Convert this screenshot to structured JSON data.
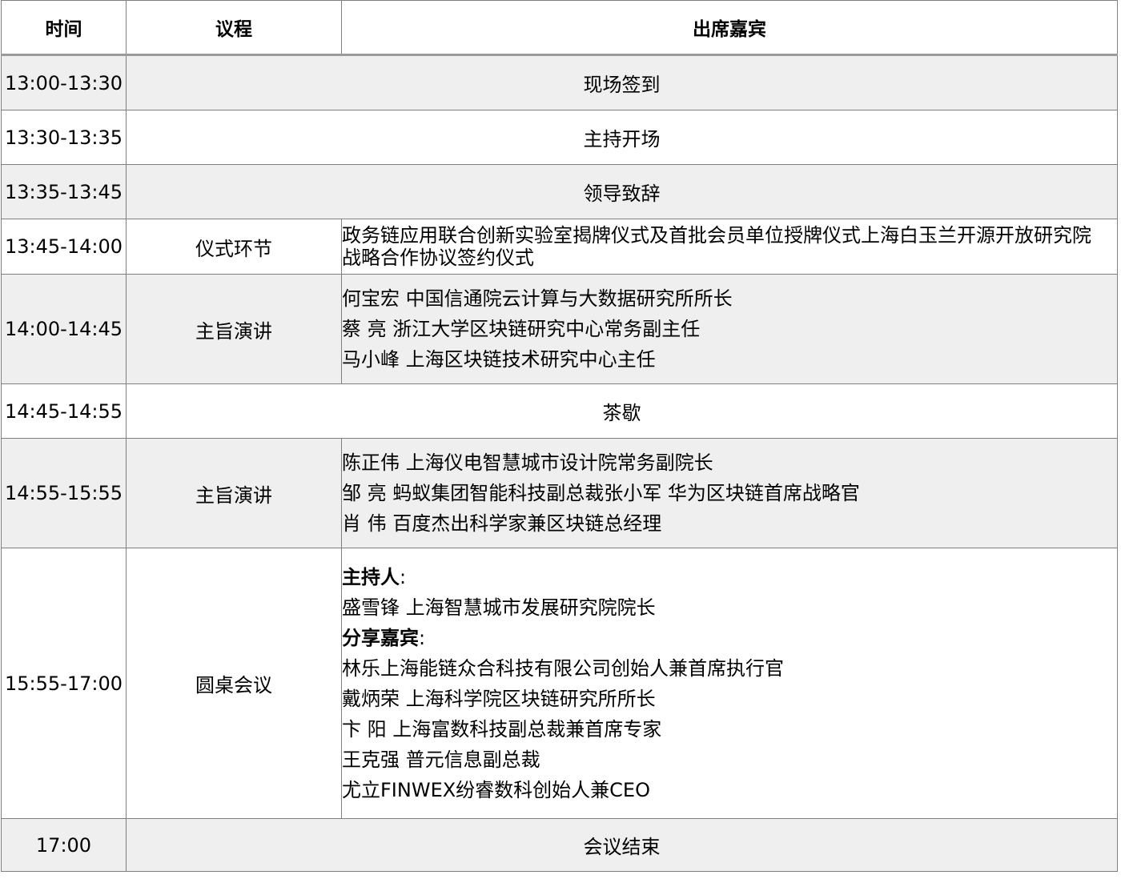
{
  "header": {
    "time": "时间",
    "agenda": "议程",
    "guests": "出席嘉宾"
  },
  "rows": [
    {
      "time": "13:00-13:30",
      "span": "现场签到"
    },
    {
      "time": "13:30-13:35",
      "span": "主持开场"
    },
    {
      "time": "13:35-13:45",
      "span": "领导致辞"
    },
    {
      "time": "13:45-14:00",
      "topic": "仪式环节",
      "guests": [
        "政务链应用联合创新实验室揭牌仪式及首批会员单位授牌仪式上海白玉兰开源开放研究院",
        "战略合作协议签约仪式"
      ]
    },
    {
      "time": "14:00-14:45",
      "topic": "主旨演讲",
      "guests": [
        "何宝宏  中国信通院云计算与大数据研究所所长",
        "蔡   亮  浙江大学区块链研究中心常务副主任",
        "马小峰  上海区块链技术研究中心主任"
      ]
    },
    {
      "time": "14:45-14:55",
      "span": "茶歇"
    },
    {
      "time": "14:55-15:55",
      "topic": "主旨演讲",
      "guests": [
        "陈正伟  上海仪电智慧城市设计院常务副院长",
        "邹   亮   蚂蚁集团智能科技副总裁张小军 华为区块链首席战略官",
        "肖   伟   百度杰出科学家兼区块链总经理"
      ]
    },
    {
      "time": "15:55-17:00",
      "topic": "圆桌会议",
      "host_label": "主持人",
      "host": "盛雪锋 上海智慧城市发展研究院院长",
      "share_label": "分享嘉宾",
      "guests": [
        "林乐上海能链众合科技有限公司创始人兼首席执行官",
        "戴炳荣 上海科学院区块链研究所所长",
        "卞 阳 上海富数科技副总裁兼首席专家",
        "王克强 普元信息副总裁",
        "尤立FINWEX纷睿数科创始人兼CEO"
      ]
    },
    {
      "time": "17:00",
      "span": "会议结束"
    }
  ]
}
